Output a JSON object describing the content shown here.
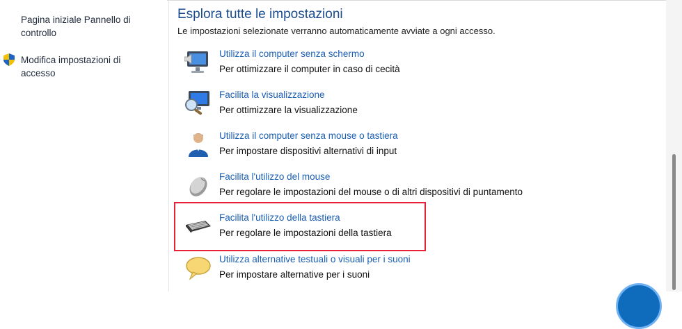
{
  "sidebar": {
    "home_link": "Pagina iniziale Pannello di controllo",
    "signin_link": "Modifica impostazioni di accesso"
  },
  "main": {
    "title": "Esplora tutte le impostazioni",
    "subtitle": "Le impostazioni selezionate verranno automaticamente avviate a ogni accesso.",
    "items": [
      {
        "link": "Utilizza il computer senza schermo",
        "desc": "Per ottimizzare il computer in caso di cecità",
        "icon": "monitor-speaker-icon"
      },
      {
        "link": "Facilita la visualizzazione",
        "desc": "Per ottimizzare la visualizzazione",
        "icon": "monitor-magnifier-icon"
      },
      {
        "link": "Utilizza il computer senza mouse o tastiera",
        "desc": "Per impostare dispositivi alternativi di input",
        "icon": "user-icon"
      },
      {
        "link": "Facilita l'utilizzo del mouse",
        "desc": "Per regolare le impostazioni del mouse o di altri dispositivi di puntamento",
        "icon": "mouse-icon"
      },
      {
        "link": "Facilita l'utilizzo della tastiera",
        "desc": "Per regolare le impostazioni della tastiera",
        "icon": "keyboard-icon"
      },
      {
        "link": "Utilizza alternative testuali o visuali per i suoni",
        "desc": "Per impostare alternative per i suoni",
        "icon": "speech-bubble-icon"
      }
    ]
  },
  "colors": {
    "link": "#1a5fb4",
    "title": "#1a4b8c",
    "highlight": "#e8203a"
  }
}
